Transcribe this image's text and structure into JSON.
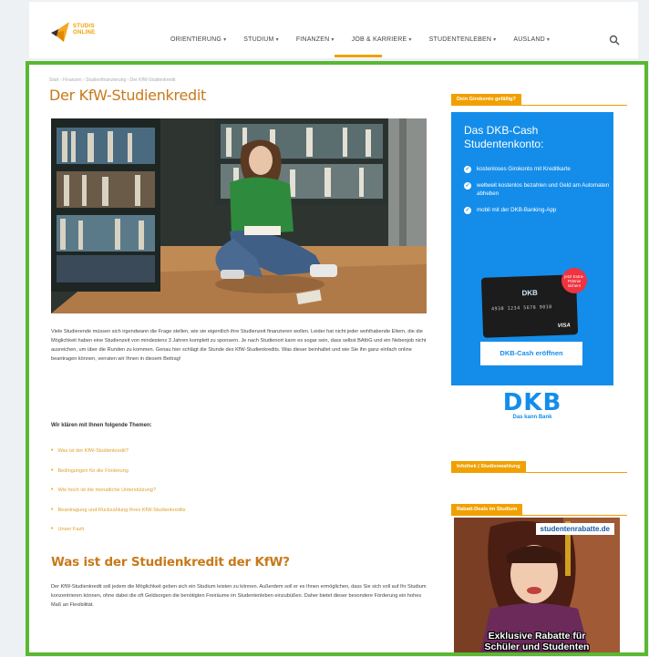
{
  "header": {
    "logo_text_line1": "STUDIS",
    "logo_text_line2": "ONLINE",
    "nav": [
      {
        "label": "ORIENTIERUNG"
      },
      {
        "label": "STUDIUM"
      },
      {
        "label": "FINANZEN"
      },
      {
        "label": "JOB & KARRIERE"
      },
      {
        "label": "STUDENTENLEBEN"
      },
      {
        "label": "AUSLAND"
      }
    ],
    "nav_chevron": "▾",
    "active_nav": "FINANZEN"
  },
  "main": {
    "breadcrumb": "Start › Finanzen › Studienfinanzierung › Der KfW-Studienkredit",
    "title": "Der KfW-Studienkredit",
    "intro": "Viele Studierende müssen sich irgendwann die Frage stellen, wie sie eigentlich ihre Studienzeit finanzieren wollen. Leider hat nicht jeder wohlhabende Eltern, die die Möglichkeit haben eine Studienzeit von mindestens 3 Jahren komplett zu sponsern. Je nach Studienort kann es sogar sein, dass selbst BAföG und ein Nebenjob nicht ausreichen, um über die Runden zu kommen. Genau hier schlägt die Stunde des KfW-Studienkredits. Was dieser beinhaltet und wie Sie ihn ganz einfach online beantragen können, verraten wir Ihnen in diesem Beitrag!",
    "toc_heading": "Wir klären mit Ihnen folgende Themen:",
    "toc": [
      "Was ist der KfW-Studienkredit?",
      "Bedingungen für die Förderung",
      "Wie hoch ist die monatliche Unterstützung?",
      "Beantragung und Rückzahlung Ihres KfW-Studienkredits",
      "Unser Fazit"
    ],
    "h2": "Was ist der Studienkredit der KfW?",
    "para2": "Der KfW-Studienkredit soll jedem die Möglichkeit geben sich ein Studium leisten zu können. Außerdem soll er es Ihnen ermöglichen, dass Sie sich voll auf Ihr Studium konzentrieren können, ohne dabei die oft Geldsorgen die benötigten Freiräume im Studentenleben einzubüßen. Daher bietet dieser besondere Förderung ein hohes Maß an Flexibilität."
  },
  "sidebar": {
    "label1": "Dein Girokonto gefällig?",
    "ad": {
      "title_line1": "Das DKB-Cash",
      "title_line2": "Studentenkonto:",
      "bullets": [
        "kostenloses Girokonto mit Kreditkarte",
        "weltweit kostenlos bezahlen und Geld am Automaten abheben",
        "mobil mit der DKB-Banking-App"
      ],
      "badge": "jetzt Extra-Prämie sichern",
      "card_brand": "DKB",
      "card_number": "4930 1234 5678 9010",
      "card_network": "VISA",
      "button": "DKB-Cash eröffnen",
      "logo": "DKB",
      "slogan": "Das kann Bank"
    },
    "label2": "Infothek | Studienwahlung",
    "label3": "Rabatt-Deals im Studium",
    "promo": {
      "brand": "studentenrabatte.de",
      "text_line1": "Exklusive Rabatte für",
      "text_line2": "Schüler und Studenten"
    }
  },
  "colors": {
    "accent": "#f0a000",
    "title": "#c8791a",
    "frame": "#5ab832",
    "dkb_blue": "#148dea"
  }
}
